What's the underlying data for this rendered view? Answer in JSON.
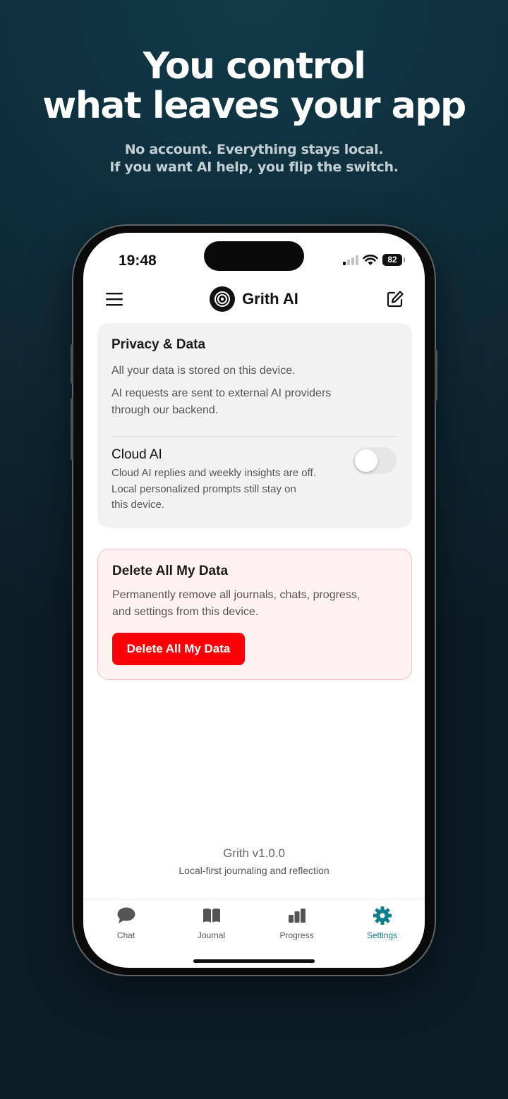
{
  "hero": {
    "title_line1": "You control",
    "title_line2": "what leaves your app",
    "subtitle_line1": "No account. Everything stays local.",
    "subtitle_line2": "If you want AI help, you flip the switch."
  },
  "status_bar": {
    "time": "19:48",
    "battery": "82"
  },
  "header": {
    "title": "Grith AI",
    "menu_icon": "menu-icon",
    "edit_icon": "compose-icon"
  },
  "privacy_card": {
    "title": "Privacy & Data",
    "storage_text": "All your data is stored on this device.",
    "ai_text_line1": "AI requests are sent to external AI providers",
    "ai_text_line2": "through our backend.",
    "cloud_ai_label": "Cloud AI",
    "cloud_ai_desc_line1": "Cloud AI replies and weekly insights are off.",
    "cloud_ai_desc_line2": "Local personalized prompts still stay on",
    "cloud_ai_desc_line3": "this device.",
    "cloud_ai_enabled": false
  },
  "delete_card": {
    "title": "Delete All My Data",
    "text_line1": "Permanently remove all journals, chats, progress,",
    "text_line2": "and settings from this device.",
    "button_label": "Delete All My Data"
  },
  "footer": {
    "version": "Grith v1.0.0",
    "tagline": "Local-first journaling and reflection"
  },
  "tabs": [
    {
      "label": "Chat",
      "icon": "chat-bubble-icon"
    },
    {
      "label": "Journal",
      "icon": "book-icon"
    },
    {
      "label": "Progress",
      "icon": "bar-chart-icon"
    },
    {
      "label": "Settings",
      "icon": "gear-icon",
      "active": true
    }
  ],
  "colors": {
    "accent": "#117e8c",
    "danger": "#fb0007",
    "danger_card_bg": "#fff2f1",
    "card_bg": "#f2f2f3"
  }
}
